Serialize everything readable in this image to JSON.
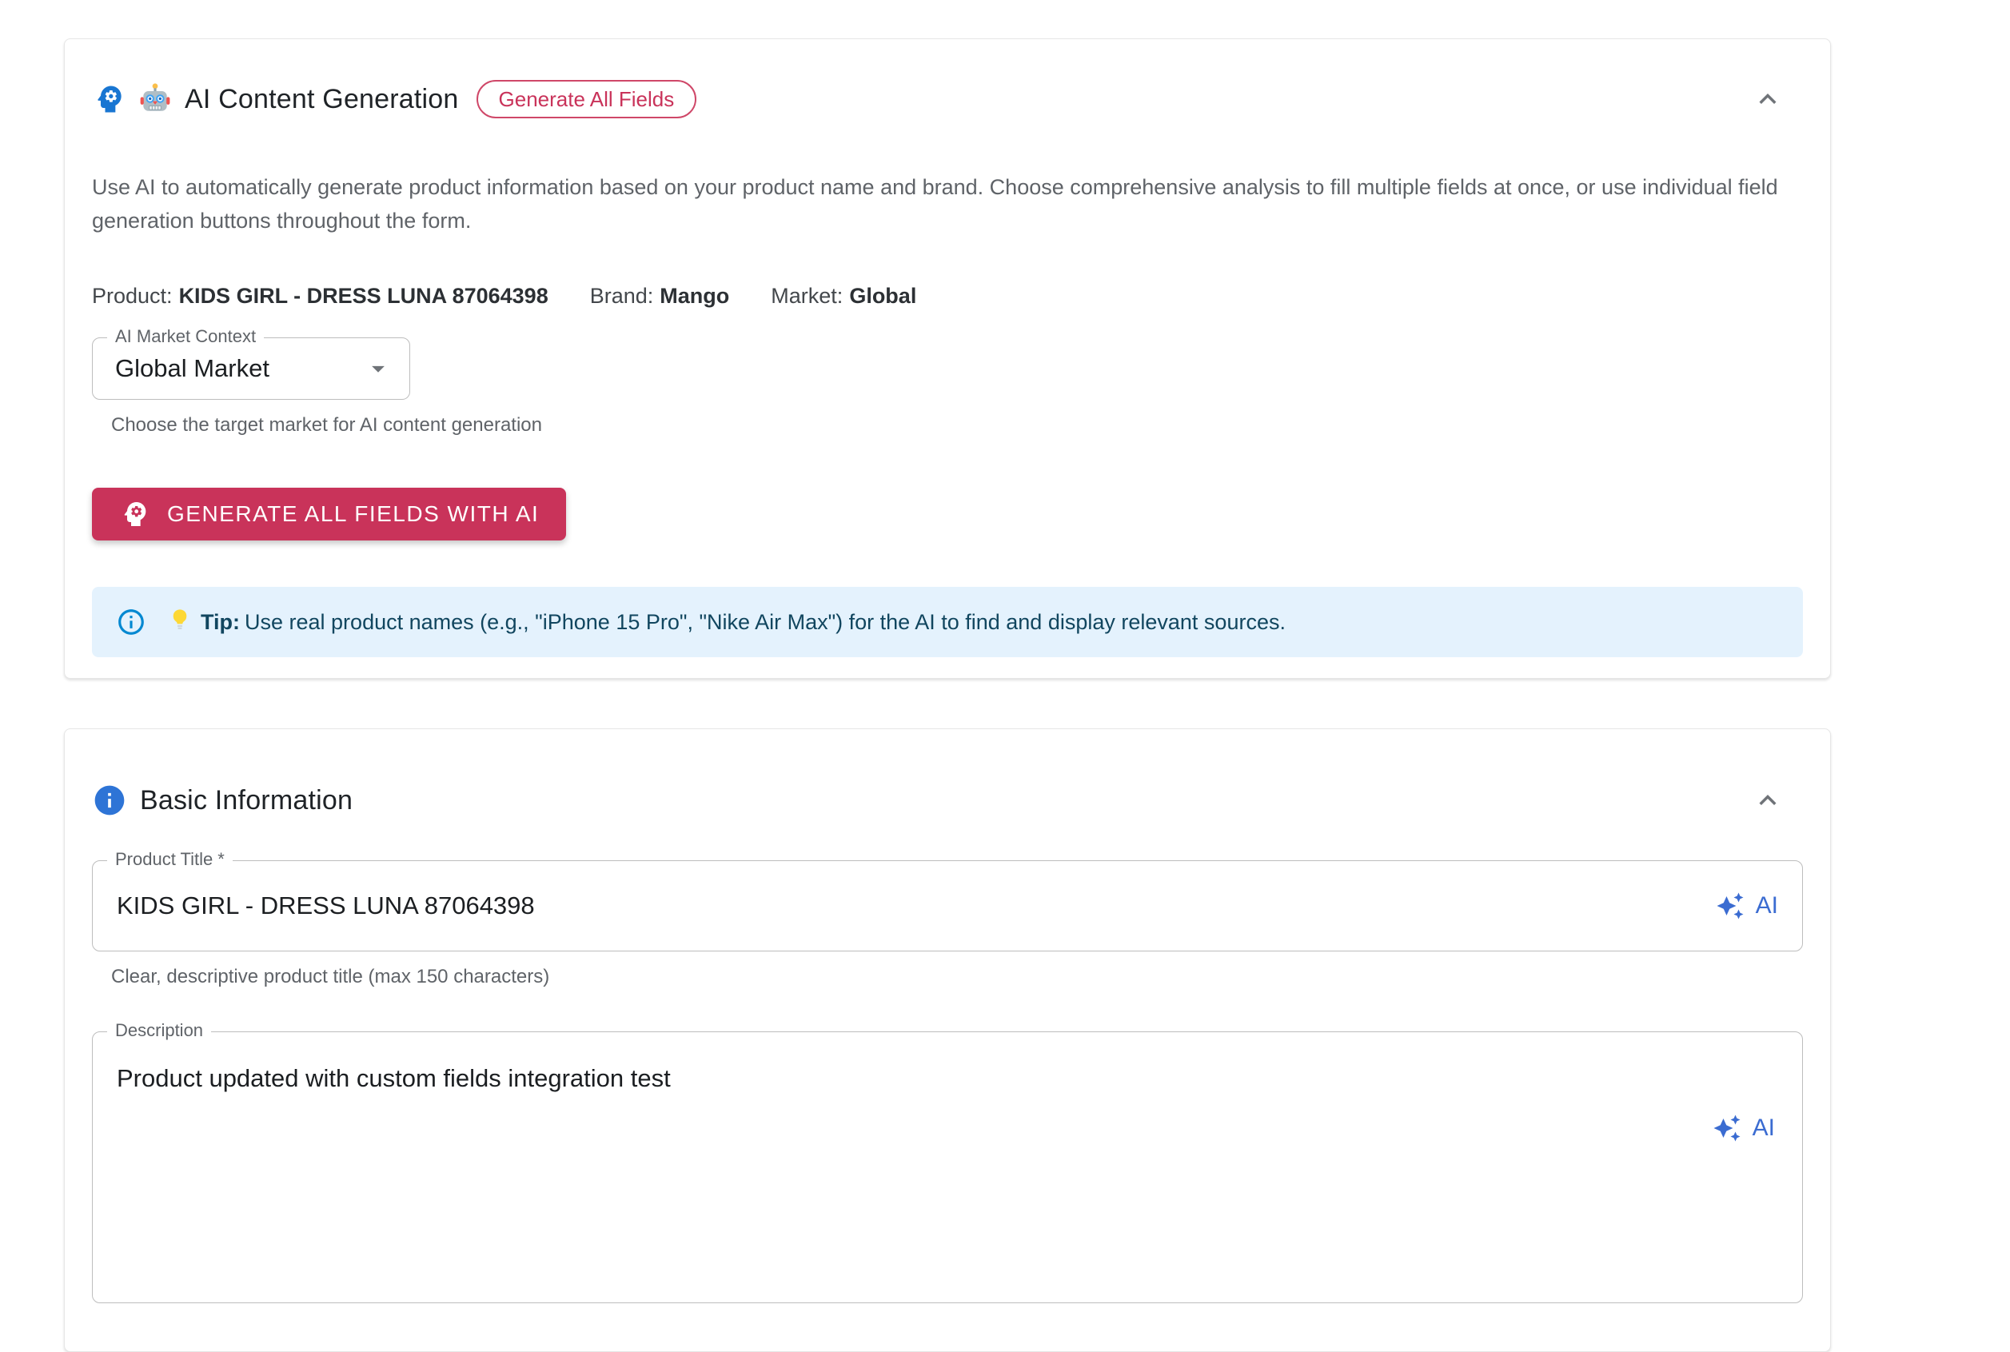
{
  "ai_section": {
    "title": "AI Content Generation",
    "robot_emoji": "🤖",
    "chip_label": "Generate All Fields",
    "description": "Use AI to automatically generate product information based on your product name and brand. Choose comprehensive analysis to fill multiple fields at once, or use individual field generation buttons throughout the form.",
    "meta": {
      "product_label": "Product:",
      "product_value": "KIDS GIRL - DRESS LUNA 87064398",
      "brand_label": "Brand:",
      "brand_value": "Mango",
      "market_label": "Market:",
      "market_value": "Global"
    },
    "market_select": {
      "label": "AI Market Context",
      "value": "Global Market",
      "helper": "Choose the target market for AI content generation"
    },
    "generate_button_label": "GENERATE ALL FIELDS WITH AI",
    "tip": {
      "lightbulb_emoji": "💡",
      "label": "Tip:",
      "text": "Use real product names (e.g., \"iPhone 15 Pro\", \"Nike Air Max\") for the AI to find and display relevant sources."
    }
  },
  "basic_section": {
    "title": "Basic Information",
    "product_title_field": {
      "label": "Product Title",
      "required_mark": "*",
      "value": "KIDS GIRL - DRESS LUNA 87064398",
      "helper": "Clear, descriptive product title (max 150 characters)",
      "ai_button_label": "AI"
    },
    "description_field": {
      "label": "Description",
      "value": "Product updated with custom fields integration test",
      "ai_button_label": "AI"
    }
  },
  "colors": {
    "accent_pink": "#c9335a",
    "header_icon_blue": "#1976d2",
    "info_badge_blue": "#2e74d6",
    "ai_button_blue": "#3b6cd1",
    "tip_icon_blue": "#0288d1",
    "tip_background": "#e4f2fd",
    "tip_text": "#11465f"
  }
}
